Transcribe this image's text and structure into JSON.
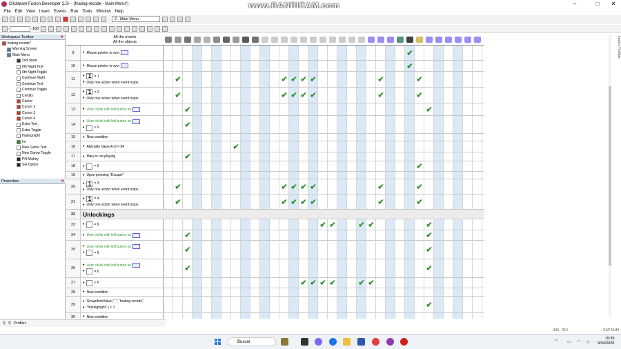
{
  "window": {
    "title": "Clickteam Fusion Developer 2.5+ - [fnatiog-recode - Main Menu*]",
    "watermark": "www.BANDICAM.com"
  },
  "menu": [
    "File",
    "Edit",
    "View",
    "Insert",
    "Events",
    "Run",
    "Tools",
    "Window",
    "Help"
  ],
  "toolbar": {
    "frame_select": "2 - Main Menu",
    "zoom": "100"
  },
  "workspace": {
    "title": "Workspace Toolbar",
    "items": [
      {
        "label": "fnatiog-recode*",
        "indent": 0,
        "color": "#c0392b"
      },
      {
        "label": "Warning Screen",
        "indent": 1,
        "color": "#5577aa"
      },
      {
        "label": "Main Menu",
        "indent": 1,
        "color": "#5577aa"
      },
      {
        "label": "2nd Static",
        "indent": 3,
        "color": "#333333"
      },
      {
        "label": "6th Night Text",
        "indent": 3,
        "color": "#ffffff"
      },
      {
        "label": "6th Night Toggle",
        "indent": 3,
        "color": "#ffffff"
      },
      {
        "label": "Continue Night",
        "indent": 3,
        "color": "#ffffff"
      },
      {
        "label": "Continue Text",
        "indent": 3,
        "color": "#ffffff"
      },
      {
        "label": "Continue Toggle",
        "indent": 3,
        "color": "#ffffff"
      },
      {
        "label": "Credits",
        "indent": 3,
        "color": "#ffffff"
      },
      {
        "label": "Cursor",
        "indent": 3,
        "color": "#c0392b"
      },
      {
        "label": "Cursor 2",
        "indent": 3,
        "color": "#c0392b"
      },
      {
        "label": "Cursor 3",
        "indent": 3,
        "color": "#c0392b"
      },
      {
        "label": "Cursor 4",
        "indent": 3,
        "color": "#c0392b"
      },
      {
        "label": "Extra Text",
        "indent": 3,
        "color": "#ffffff"
      },
      {
        "label": "Extra Toggle",
        "indent": 3,
        "color": "#ffffff"
      },
      {
        "label": "fnatiognight",
        "indent": 3,
        "color": "#ffffff"
      },
      {
        "label": "Ini",
        "indent": 3,
        "color": "#2a8a2a"
      },
      {
        "label": "New Game Text",
        "indent": 3,
        "color": "#ffffff"
      },
      {
        "label": "New Gamw Toggle",
        "indent": 3,
        "color": "#ffffff"
      },
      {
        "label": "PN Mickey",
        "indent": 3,
        "color": "#222222"
      },
      {
        "label": "Sel Option",
        "indent": 3,
        "color": "#222222"
      }
    ]
  },
  "properties": {
    "title": "Properties"
  },
  "bottom": {
    "tab": "Profiler"
  },
  "editor": {
    "header_line1": "All the events",
    "header_line2": "All the objects",
    "rows": [
      {
        "num": "9",
        "h": 22,
        "lines": [
          {
            "text": "Mouse pointer is over",
            "green": false,
            "box": "btn"
          }
        ],
        "checks": [
          25
        ]
      },
      {
        "num": "10",
        "h": 16,
        "lines": [
          {
            "text": "Mouse pointer is over",
            "green": false,
            "box": "btn"
          }
        ],
        "checks": [
          25
        ]
      },
      {
        "num": "11",
        "h": 23,
        "lines": [
          {
            "text": "= 1",
            "green": false,
            "box": "one"
          },
          {
            "text": "Only one action when event loops",
            "green": false,
            "box": ""
          }
        ],
        "checks": [
          1,
          12,
          13,
          14,
          15,
          22,
          26
        ]
      },
      {
        "num": "12",
        "h": 23,
        "lines": [
          {
            "text": "= 2",
            "green": false,
            "box": "one"
          },
          {
            "text": "Only one action when event loops",
            "green": false,
            "box": ""
          }
        ],
        "checks": [
          1,
          12,
          13,
          14,
          15,
          22,
          26
        ]
      },
      {
        "num": "13",
        "h": 18,
        "lines": [
          {
            "text": "User clicks with left button on",
            "green": true,
            "box": "btn"
          }
        ],
        "checks": [
          2,
          27
        ]
      },
      {
        "num": "14",
        "h": 26,
        "lines": [
          {
            "text": "User clicks with left button on",
            "green": true,
            "box": "btn"
          },
          {
            "text": "> 0",
            "green": false,
            "box": "plain"
          }
        ],
        "checks": [
          2
        ]
      },
      {
        "num": "15",
        "h": 11,
        "lines": [
          {
            "text": "New condition",
            "green": false,
            "box": ""
          }
        ],
        "checks": []
      },
      {
        "num": "16",
        "h": 16,
        "lines": [
          {
            "text": "Alterable Value A of  = 94",
            "green": false,
            "box": ""
          }
        ],
        "checks": [
          7
        ]
      },
      {
        "num": "17",
        "h": 13,
        "lines": [
          {
            "text": "Mary is not playing",
            "green": false,
            "box": ""
          }
        ],
        "checks": [
          2
        ]
      },
      {
        "num": "18",
        "h": 15,
        "lines": [
          {
            "text": "= 0",
            "green": false,
            "box": "plain"
          }
        ],
        "checks": [
          26
        ]
      },
      {
        "num": "19",
        "h": 11,
        "lines": [
          {
            "text": "Upon pressing \"Escape\"",
            "green": false,
            "box": ""
          }
        ],
        "checks": []
      },
      {
        "num": "20",
        "h": 22,
        "lines": [
          {
            "text": "= 3",
            "green": false,
            "box": "one"
          },
          {
            "text": "Only one action when event loops",
            "green": false,
            "box": ""
          }
        ],
        "checks": [
          1,
          12,
          13,
          14,
          15,
          22,
          26
        ]
      },
      {
        "num": "21",
        "h": 22,
        "lines": [
          {
            "text": "= 4",
            "green": false,
            "box": "one"
          },
          {
            "text": "Only one action when event loops",
            "green": false,
            "box": ""
          }
        ],
        "checks": [
          1,
          12,
          13,
          14,
          15,
          22,
          26
        ]
      },
      {
        "num": "22",
        "h": 14,
        "group": true,
        "lines": [
          {
            "text": "Unlockings",
            "green": false,
            "box": ""
          }
        ],
        "checks": []
      },
      {
        "num": "23",
        "h": 16,
        "lines": [
          {
            "text": "= 6",
            "green": false,
            "box": "plain"
          }
        ],
        "checks": [
          16,
          17,
          20,
          21,
          27
        ]
      },
      {
        "num": "24",
        "h": 15,
        "lines": [
          {
            "text": "User clicks with left button on",
            "green": true,
            "box": "btn"
          }
        ],
        "checks": [
          2,
          27
        ]
      },
      {
        "num": "25",
        "h": 27,
        "lines": [
          {
            "text": "User clicks with left button on",
            "green": true,
            "box": "btn"
          },
          {
            "text": "= 6",
            "green": false,
            "box": "plain"
          }
        ],
        "checks": [
          2,
          27
        ]
      },
      {
        "num": "26",
        "h": 27,
        "lines": [
          {
            "text": "User clicks with left button on",
            "green": true,
            "box": "btn"
          },
          {
            "text": "= 6",
            "green": false,
            "box": "plain"
          }
        ],
        "checks": [
          2,
          27
        ]
      },
      {
        "num": "27",
        "h": 15,
        "lines": [
          {
            "text": "< 6",
            "green": false,
            "box": "plain"
          }
        ],
        "checks": [
          14,
          15,
          16,
          17,
          20,
          21
        ]
      },
      {
        "num": "28",
        "h": 12,
        "lines": [
          {
            "text": "New condition",
            "green": false,
            "box": ""
          }
        ],
        "checks": []
      },
      {
        "num": "29",
        "h": 24,
        "lines": [
          {
            "text": "GroupItemValue( \"  \", \"fnatiog-recode\",",
            "green": false,
            "box": ""
          },
          {
            "text": "\"fnatiognight\" ) < 1",
            "green": false,
            "box": ""
          }
        ],
        "checks": [
          27
        ]
      },
      {
        "num": "30",
        "h": 12,
        "lines": [
          {
            "text": "New condition",
            "green": false,
            "box": ""
          }
        ],
        "checks": []
      }
    ]
  },
  "right_tool": "Layers Toolbar",
  "status": {
    "coords": "-345, -210",
    "caps": "CAP  NUM"
  },
  "taskbar": {
    "search": "Buscar",
    "time": "19:39",
    "date": "9/04/2026"
  }
}
